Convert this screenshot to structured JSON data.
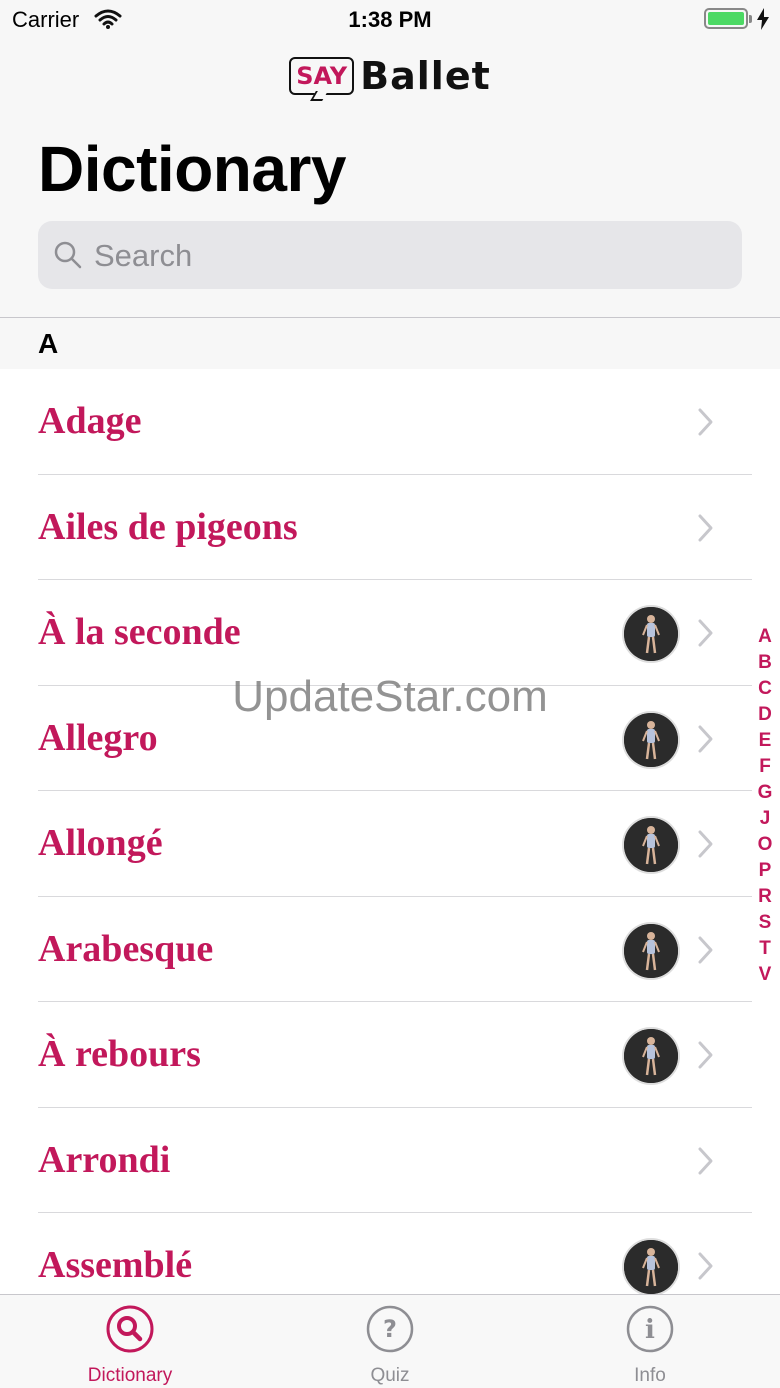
{
  "status_bar": {
    "carrier": "Carrier",
    "time": "1:38 PM"
  },
  "header": {
    "logo_say": "SAY",
    "logo_ballet": "Ballet",
    "title": "Dictionary"
  },
  "search": {
    "placeholder": "Search",
    "value": ""
  },
  "section": {
    "letter": "A"
  },
  "entries": [
    {
      "term": "Adage",
      "has_image": false
    },
    {
      "term": "Ailes de pigeons",
      "has_image": false
    },
    {
      "term": "À la seconde",
      "has_image": true
    },
    {
      "term": "Allegro",
      "has_image": true
    },
    {
      "term": "Allongé",
      "has_image": true
    },
    {
      "term": "Arabesque",
      "has_image": true
    },
    {
      "term": "À rebours",
      "has_image": true
    },
    {
      "term": "Arrondi",
      "has_image": false
    },
    {
      "term": "Assemblé",
      "has_image": true
    }
  ],
  "index_letters": [
    "A",
    "B",
    "C",
    "D",
    "E",
    "F",
    "G",
    "J",
    "O",
    "P",
    "R",
    "S",
    "T",
    "V"
  ],
  "watermark": "UpdateStar.com",
  "tabs": [
    {
      "label": "Dictionary",
      "icon": "search-icon",
      "active": true
    },
    {
      "label": "Quiz",
      "icon": "question-icon",
      "active": false
    },
    {
      "label": "Info",
      "icon": "info-icon",
      "active": false
    }
  ],
  "colors": {
    "accent": "#c2185b",
    "inactive": "#8e8e93",
    "battery": "#4cd964"
  }
}
